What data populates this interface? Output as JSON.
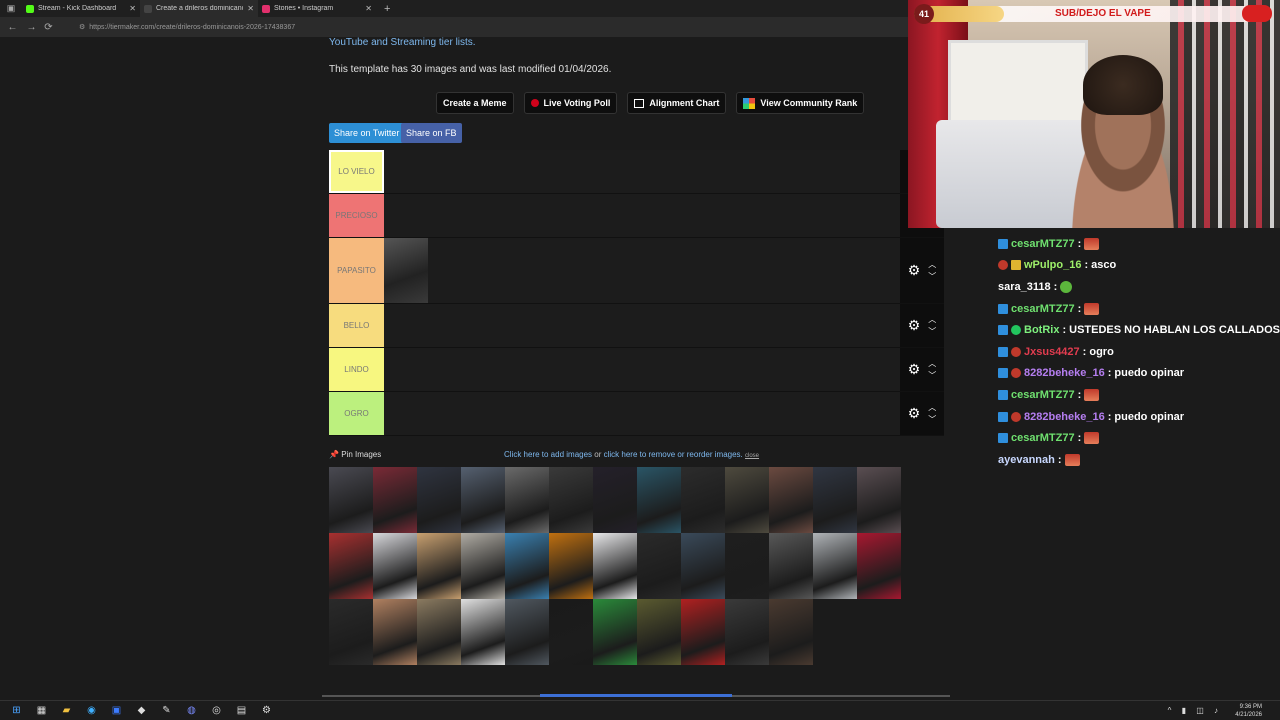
{
  "browser": {
    "tabs": [
      {
        "label": "Stream - Kick Dashboard",
        "color": "#53fc18",
        "active": false
      },
      {
        "label": "Create a drileros dominicanois 20...",
        "color": "#444444",
        "active": true
      },
      {
        "label": "Stories • Instagram",
        "color": "#e1306c",
        "active": false
      }
    ],
    "url": "https://tiermaker.com/create/drileros-dominicanois-2026-17438367"
  },
  "page": {
    "link_text": "YouTube and Streaming tier lists.",
    "template_info": "This template has 30 images and was last modified 01/04/2026.",
    "buttons": {
      "meme": "Create a Meme",
      "poll": "Live Voting Poll",
      "alignment": "Alignment Chart",
      "community": "View Community Rank"
    },
    "share_twitter": "Share on Twitter",
    "share_fb": "Share on FB",
    "tiers": [
      {
        "label": "LO VIELO",
        "color": "#f7f78a"
      },
      {
        "label": "PRECIOSO",
        "color": "#ee7474"
      },
      {
        "label": "PAPASITO",
        "color": "#f6ba7e"
      },
      {
        "label": "BELLO",
        "color": "#f7dc7e"
      },
      {
        "label": "LINDO",
        "color": "#f7f780"
      },
      {
        "label": "OGRO",
        "color": "#bcf07e"
      }
    ],
    "pin_label": "Pin Images",
    "add_images": "Click here to add images",
    "or_text": " or ",
    "remove_images": "click here to remove or reorder images.",
    "close": "close"
  },
  "stream_overlay": {
    "count": "41",
    "title": "SUB/DEJO EL VAPE"
  },
  "chat": [
    {
      "user": "cesarMTZ77",
      "color": "#6fe06f",
      "badges": [
        "bot"
      ],
      "text": "",
      "emote": "red"
    },
    {
      "user": "wPulpo_16",
      "color": "#9ef06a",
      "badges": [
        "red",
        "gold"
      ],
      "text": "asco",
      "emote": ""
    },
    {
      "user": "sara_3118",
      "color": "#ffffff",
      "badges": [],
      "text": "",
      "emote": "green"
    },
    {
      "user": "cesarMTZ77",
      "color": "#6fe06f",
      "badges": [
        "bot"
      ],
      "text": "",
      "emote": "red"
    },
    {
      "user": "BotRix",
      "color": "#7ef07e",
      "badges": [
        "bot",
        "green"
      ],
      "text": "USTEDES NO HABLAN LOS CALLADOS?",
      "emote": ""
    },
    {
      "user": "Jxsus4427",
      "color": "#e23c4f",
      "badges": [
        "bot",
        "red"
      ],
      "text": "ogro",
      "emote": ""
    },
    {
      "user": "8282beheke_16",
      "color": "#b57ef0",
      "badges": [
        "bot",
        "red"
      ],
      "text": "puedo opinar",
      "emote": ""
    },
    {
      "user": "cesarMTZ77",
      "color": "#6fe06f",
      "badges": [
        "bot"
      ],
      "text": "",
      "emote": "red"
    },
    {
      "user": "8282beheke_16",
      "color": "#b57ef0",
      "badges": [
        "bot",
        "red"
      ],
      "text": "puedo opinar",
      "emote": ""
    },
    {
      "user": "cesarMTZ77",
      "color": "#6fe06f",
      "badges": [
        "bot"
      ],
      "text": "",
      "emote": "red"
    },
    {
      "user": "ayevannah",
      "color": "#c8d8ff",
      "badges": [],
      "text": "",
      "emote": "red"
    }
  ],
  "taskbar": {
    "time": "9:36 PM",
    "date": "4/21/2026"
  }
}
